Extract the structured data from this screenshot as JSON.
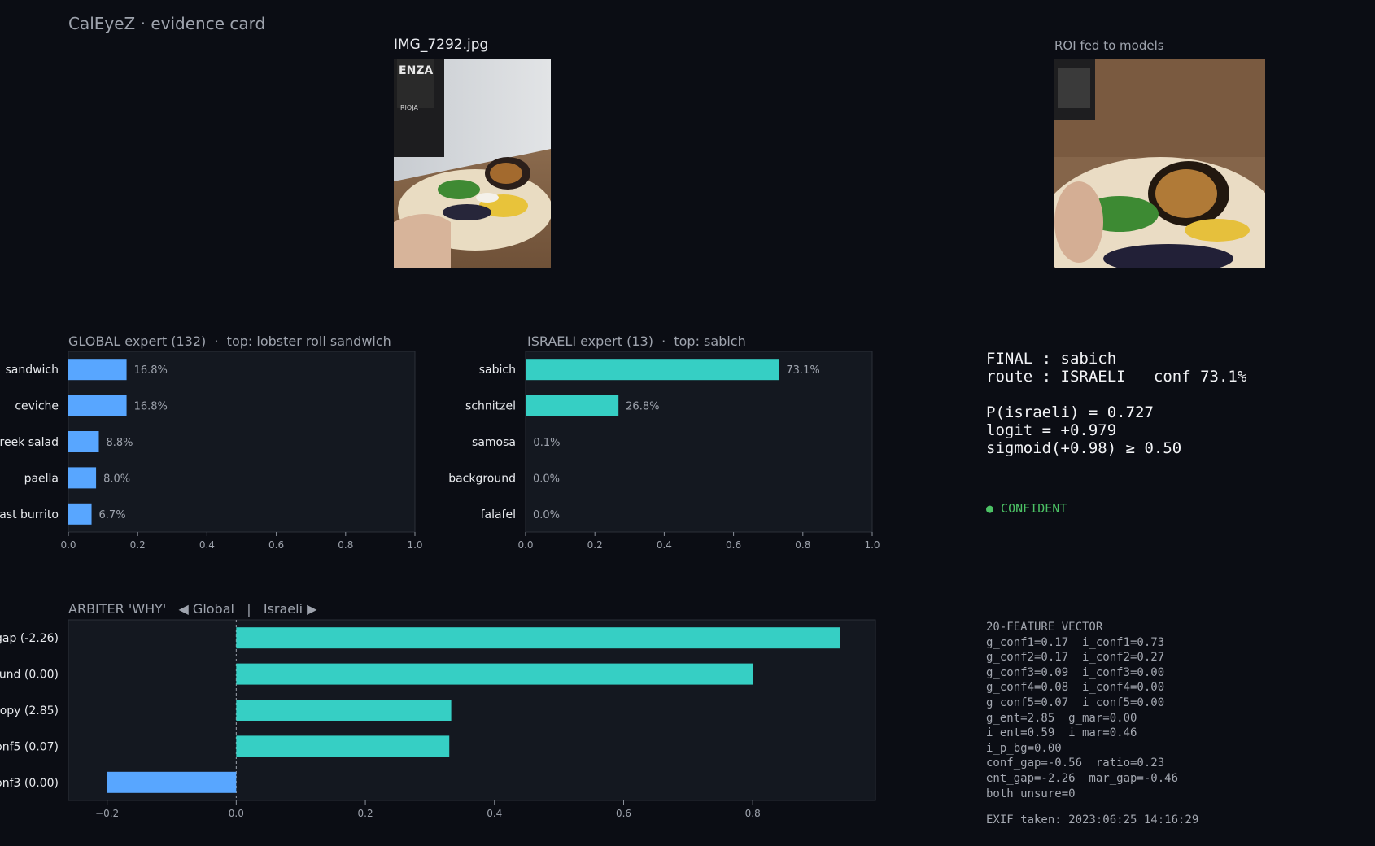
{
  "header": {
    "title": "CalEyeZ · evidence card",
    "filename": "IMG_7292.jpg",
    "roi_label": "ROI fed to models"
  },
  "global_title": "GLOBAL expert (132)  ·  top: lobster roll sandwich",
  "israeli_title": "ISRAELI expert (13)  ·  top: sabich",
  "arbiter_title": "ARBITER 'WHY'   ◀ Global   |   Israeli ▶",
  "colors": {
    "global": "#58a6ff",
    "israeli": "#36cfc4",
    "panel": "#141820",
    "confident": "#4cc265"
  },
  "chart_data": [
    {
      "type": "bar",
      "orientation": "horizontal",
      "categories": [
        "lobster roll sandwich",
        "ceviche",
        "greek salad",
        "paella",
        "breakfast burrito"
      ],
      "visible_labels": [
        "sandwich",
        "ceviche",
        "reek salad",
        "paella",
        "ast burrito"
      ],
      "values": [
        0.168,
        0.168,
        0.088,
        0.08,
        0.067
      ],
      "value_labels": [
        "16.8%",
        "16.8%",
        "8.8%",
        "8.0%",
        "6.7%"
      ],
      "xlim": [
        0,
        1.0
      ],
      "xticks": [
        "0.0",
        "0.2",
        "0.4",
        "0.6",
        "0.8",
        "1.0"
      ]
    },
    {
      "type": "bar",
      "orientation": "horizontal",
      "categories": [
        "sabich",
        "schnitzel",
        "samosa",
        "background",
        "falafel"
      ],
      "visible_labels": [
        "sabich",
        "schnitzel",
        "samosa",
        "background",
        "falafel"
      ],
      "values": [
        0.731,
        0.268,
        0.001,
        0.0,
        0.0
      ],
      "value_labels": [
        "73.1%",
        "26.8%",
        "0.1%",
        "0.0%",
        "0.0%"
      ],
      "xlim": [
        0,
        1.0
      ],
      "xticks": [
        "0.0",
        "0.2",
        "0.4",
        "0.6",
        "0.8",
        "1.0"
      ]
    },
    {
      "type": "bar",
      "orientation": "horizontal",
      "visible_labels": [
        "gap (-2.26)",
        "und (0.00)",
        "ropy (2.85)",
        "onf5 (0.07)",
        "onf3 (0.00)"
      ],
      "values": [
        0.935,
        0.8,
        0.333,
        0.33,
        -0.2
      ],
      "xlim": [
        -0.26,
        0.99
      ],
      "xticks": [
        "−0.2",
        "0.0",
        "0.2",
        "0.4",
        "0.6",
        "0.8"
      ],
      "xtick_values": [
        -0.2,
        0.0,
        0.2,
        0.4,
        0.6,
        0.8
      ]
    }
  ],
  "final": {
    "text": "FINAL : sabich\nroute : ISRAELI   conf 73.1%\n\nP(israeli) = 0.727\nlogit = +0.979\nsigmoid(+0.98) ≥ 0.50",
    "confident": "● CONFIDENT"
  },
  "features": {
    "text": "20-FEATURE VECTOR\ng_conf1=0.17  i_conf1=0.73\ng_conf2=0.17  i_conf2=0.27\ng_conf3=0.09  i_conf3=0.00\ng_conf4=0.08  i_conf4=0.00\ng_conf5=0.07  i_conf5=0.00\ng_ent=2.85  g_mar=0.00\ni_ent=0.59  i_mar=0.46\ni_p_bg=0.00\nconf_gap=-0.56  ratio=0.23\nent_gap=-2.26  mar_gap=-0.46\nboth_unsure=0",
    "exif": "EXIF taken: 2023:06:25 14:16:29"
  }
}
